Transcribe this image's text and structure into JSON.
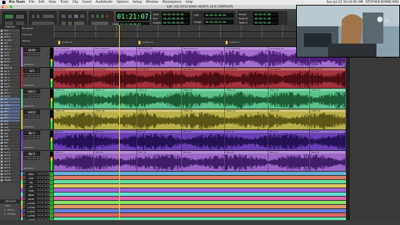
{
  "menubar": {
    "app": "Pro Tools",
    "items": [
      "File",
      "Edit",
      "View",
      "Track",
      "Clip",
      "Event",
      "AudioSuite",
      "Options",
      "Setup",
      "Window",
      "Marketplace",
      "Help"
    ],
    "clock": "Sun Jul 23  10:14:05 AM",
    "user": "STEPHEN BARNCARD"
  },
  "window": {
    "title": "Edit: 20170722 MANY HEARTS 18-6 COMPOSITE"
  },
  "toolbar": {
    "main_counter": "01:21:07:09",
    "cursor_label": "Cursor",
    "cursor_value": "01:21:06:08.64",
    "start_label": "Start",
    "end_label": "End",
    "length_label": "Length",
    "start_value": "00:00:00:00.00",
    "end_value": "00:00:00:00.00",
    "length_value": "00:00:00:00.00",
    "nudge_label": "Nudge",
    "nudge_value": "00:00:00:01.00",
    "grid_label": "Grid",
    "grid_value": "00:00:01:00.00",
    "pre_label": "Preroll",
    "post_label": "Postroll",
    "fade_label": "Fade-in",
    "pre_value": "00:00:01:00",
    "post_value": "00:00:01:00",
    "fade_value": "00:00:01:00"
  },
  "left_pane": {
    "tracks_header": "TRACKS",
    "track_list": [
      "Kick",
      "Kick 2",
      "Snare",
      "Snr Bot",
      "Hat",
      "Tom 1",
      "Tom 2",
      "Floor",
      "OH L",
      "OH R",
      "Room",
      "Bass",
      "Bass DI",
      "Gtr 1",
      "Gtr 2",
      "Gtr 3",
      "Gtr 4",
      "Key L",
      "Key R",
      "Org",
      "Pno L",
      "Pno R",
      "LV1",
      "LV2",
      "VOC1",
      "VOC2",
      "BV1",
      "BV2",
      "BV3",
      "BV4",
      "Perc",
      "Shkr",
      "Tamb",
      "FX1",
      "FX2",
      "Click",
      "Ref",
      "Mix",
      "Print",
      "Aux 1",
      "Aux 2",
      "Aux 3",
      "Aux 4",
      "Aux 5",
      "Aux 6",
      "Aux 7",
      "Aux 8",
      "Aux 9",
      "Master"
    ],
    "groups_header": "GROUPS",
    "groups": [
      "<ALL>",
      "a - Drums",
      "b - FX Buss"
    ]
  },
  "rulers": {
    "labels": [
      "Bars|Beats",
      "Timecode",
      "Markers"
    ],
    "marker_names": [
      "Location 5",
      "Location 6",
      "Location 7"
    ]
  },
  "tracks": [
    {
      "name": "LEAD",
      "view": "waveform",
      "color": "#a56fd0",
      "dark": "#4a1f76",
      "clip_name": "LV-1 Comp_03"
    },
    {
      "name": "LV1",
      "view": "waveform",
      "color": "#a3323d",
      "dark": "#4c0d14",
      "clip_name": "LV1_AD-14"
    },
    {
      "name": "VOC1",
      "view": "waveform",
      "color": "#5bc28a",
      "dark": "#1b5c36",
      "clip_name": "VOC1_13"
    },
    {
      "name": "VOC2",
      "view": "waveform",
      "color": "#b8b04a",
      "dark": "#5b5516",
      "clip_name": "VOC2_18"
    },
    {
      "name": "BV-1",
      "view": "waveform",
      "color": "#6a3fb6",
      "dark": "#261257",
      "clip_name": "BV-1_07"
    },
    {
      "name": "BV-2",
      "view": "waveform",
      "color": "#9a66c8",
      "dark": "#3f1d6a",
      "clip_name": "BV-2_11"
    }
  ],
  "small_tracks": [
    {
      "name": "VOX1",
      "color": "#4fa3d9"
    },
    {
      "name": "GTR",
      "color": "#d96a4f"
    },
    {
      "name": "SN",
      "color": "#4fd98e"
    },
    {
      "name": "OH",
      "color": "#d9c24f"
    },
    {
      "name": "TOM",
      "color": "#9b4fd9"
    },
    {
      "name": "BASS",
      "color": "#4fd9d2"
    },
    {
      "name": "KICK",
      "color": "#d94f9b"
    },
    {
      "name": "C-VOX1",
      "color": "#7ad94f"
    },
    {
      "name": "C-VOX2",
      "color": "#d9894f"
    },
    {
      "name": "C-GTR1",
      "color": "#4f6ed9"
    },
    {
      "name": "C-GTR2",
      "color": "#d94f4f"
    },
    {
      "name": "C-PIANO",
      "color": "#4fd9a6"
    },
    {
      "name": "C-KEYS",
      "color": "#b94fd9"
    }
  ]
}
